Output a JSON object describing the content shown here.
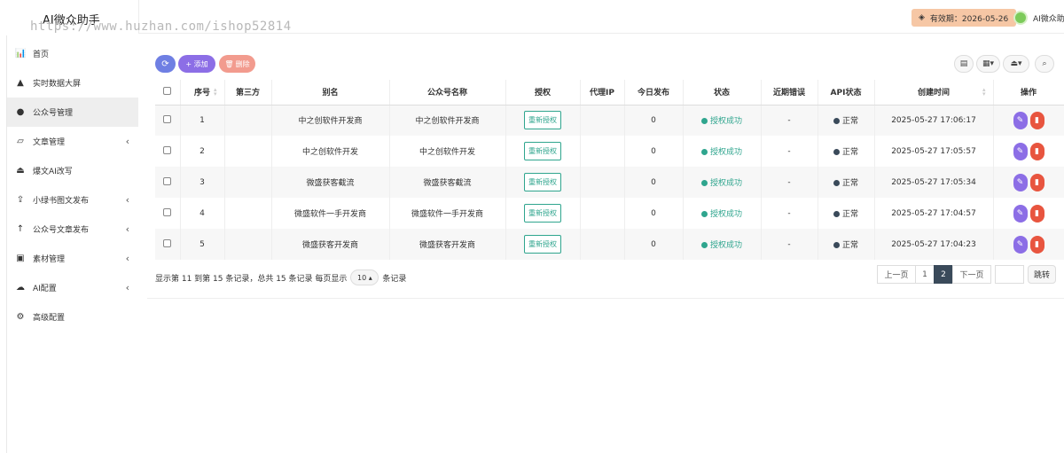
{
  "app": {
    "title": "AI微众助手",
    "watermark": "https://www.huzhan.com/ishop52814"
  },
  "header": {
    "expiry_label": "有效期：2026-05-26",
    "user_name": "AI微众助"
  },
  "sidebar": {
    "items": [
      {
        "label": "首页",
        "icon": "bar-chart-icon"
      },
      {
        "label": "实时数据大屏",
        "icon": "area-chart-icon"
      },
      {
        "label": "公众号管理",
        "icon": "wechat-icon",
        "active": true
      },
      {
        "label": "文章管理",
        "icon": "folder-open-icon",
        "arrow": "‹"
      },
      {
        "label": "爆文AI改写",
        "icon": "eject-icon"
      },
      {
        "label": "小绿书图文发布",
        "icon": "upload-icon",
        "arrow": "‹"
      },
      {
        "label": "公众号文章发布",
        "icon": "arrow-up-icon",
        "arrow": "‹"
      },
      {
        "label": "素材管理",
        "icon": "image-icon",
        "arrow": "‹"
      },
      {
        "label": "AI配置",
        "icon": "cloud-icon",
        "arrow": "‹"
      },
      {
        "label": "高级配置",
        "icon": "gear-icon"
      }
    ]
  },
  "toolbar": {
    "add_label": "+ 添加",
    "delete_label": "删除"
  },
  "table": {
    "columns": [
      "序号",
      "第三方",
      "别名",
      "公众号名称",
      "授权",
      "代理IP",
      "今日发布",
      "状态",
      "近期错误",
      "API状态",
      "创建时间",
      "操作"
    ],
    "reauth_label": "重新授权",
    "rows": [
      {
        "no": "1",
        "third": "",
        "alias": "中之创软件开发商",
        "name": "中之创软件开发商",
        "proxy": "",
        "today": "0",
        "status": "授权成功",
        "error": "-",
        "api": "正常",
        "created": "2025-05-27 17:06:17"
      },
      {
        "no": "2",
        "third": "",
        "alias": "中之创软件开发",
        "name": "中之创软件开发",
        "proxy": "",
        "today": "0",
        "status": "授权成功",
        "error": "-",
        "api": "正常",
        "created": "2025-05-27 17:05:57"
      },
      {
        "no": "3",
        "third": "",
        "alias": "微盛获客截流",
        "name": "微盛获客截流",
        "proxy": "",
        "today": "0",
        "status": "授权成功",
        "error": "-",
        "api": "正常",
        "created": "2025-05-27 17:05:34"
      },
      {
        "no": "4",
        "third": "",
        "alias": "微盛软件一手开发商",
        "name": "微盛软件一手开发商",
        "proxy": "",
        "today": "0",
        "status": "授权成功",
        "error": "-",
        "api": "正常",
        "created": "2025-05-27 17:04:57"
      },
      {
        "no": "5",
        "third": "",
        "alias": "微盛获客开发商",
        "name": "微盛获客开发商",
        "proxy": "",
        "today": "0",
        "status": "授权成功",
        "error": "-",
        "api": "正常",
        "created": "2025-05-27 17:04:23"
      }
    ]
  },
  "pagination": {
    "info_prefix": "显示第 11 到第 15 条记录，总共 15 条记录 每页显示",
    "page_size": "10 ▴",
    "info_suffix": "条记录",
    "prev": "上一页",
    "pages": [
      "1",
      "2"
    ],
    "current": "2",
    "next": "下一页",
    "jump": "跳转"
  },
  "colors": {
    "status_ok": "#2fa58e",
    "api_dot": "#3a4a5a",
    "edit": "#8c6ee6",
    "delete": "#e8553f"
  }
}
